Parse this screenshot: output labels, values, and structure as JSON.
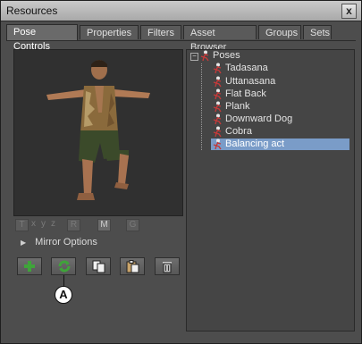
{
  "window": {
    "title": "Resources",
    "close_label": "x"
  },
  "tabs": [
    {
      "label": "Pose Controls",
      "active": true
    },
    {
      "label": "Properties",
      "active": false
    },
    {
      "label": "Filters",
      "active": false
    },
    {
      "label": "Asset Browser",
      "active": false
    },
    {
      "label": "Groups",
      "active": false
    },
    {
      "label": "Sets",
      "active": false
    }
  ],
  "axis_buttons": {
    "t": "T",
    "x": "x",
    "y": "y",
    "z": "z",
    "r": "R",
    "m": "M",
    "g": "G"
  },
  "mirror_options": {
    "label": "Mirror Options"
  },
  "toolbar": [
    "add-icon",
    "refresh-icon",
    "copy-icon",
    "paste-icon",
    "trash-icon"
  ],
  "callout": {
    "label": "A"
  },
  "tree": {
    "root": "Poses",
    "items": [
      {
        "label": "Tadasana",
        "selected": false
      },
      {
        "label": "Uttanasana",
        "selected": false
      },
      {
        "label": "Flat Back",
        "selected": false
      },
      {
        "label": "Plank",
        "selected": false
      },
      {
        "label": "Downward Dog",
        "selected": false
      },
      {
        "label": "Cobra",
        "selected": false
      },
      {
        "label": "Balancing act",
        "selected": true
      }
    ]
  },
  "colors": {
    "selection": "#7a9cc8",
    "panel": "#4d4d4d",
    "add_green": "#3fa43a"
  }
}
